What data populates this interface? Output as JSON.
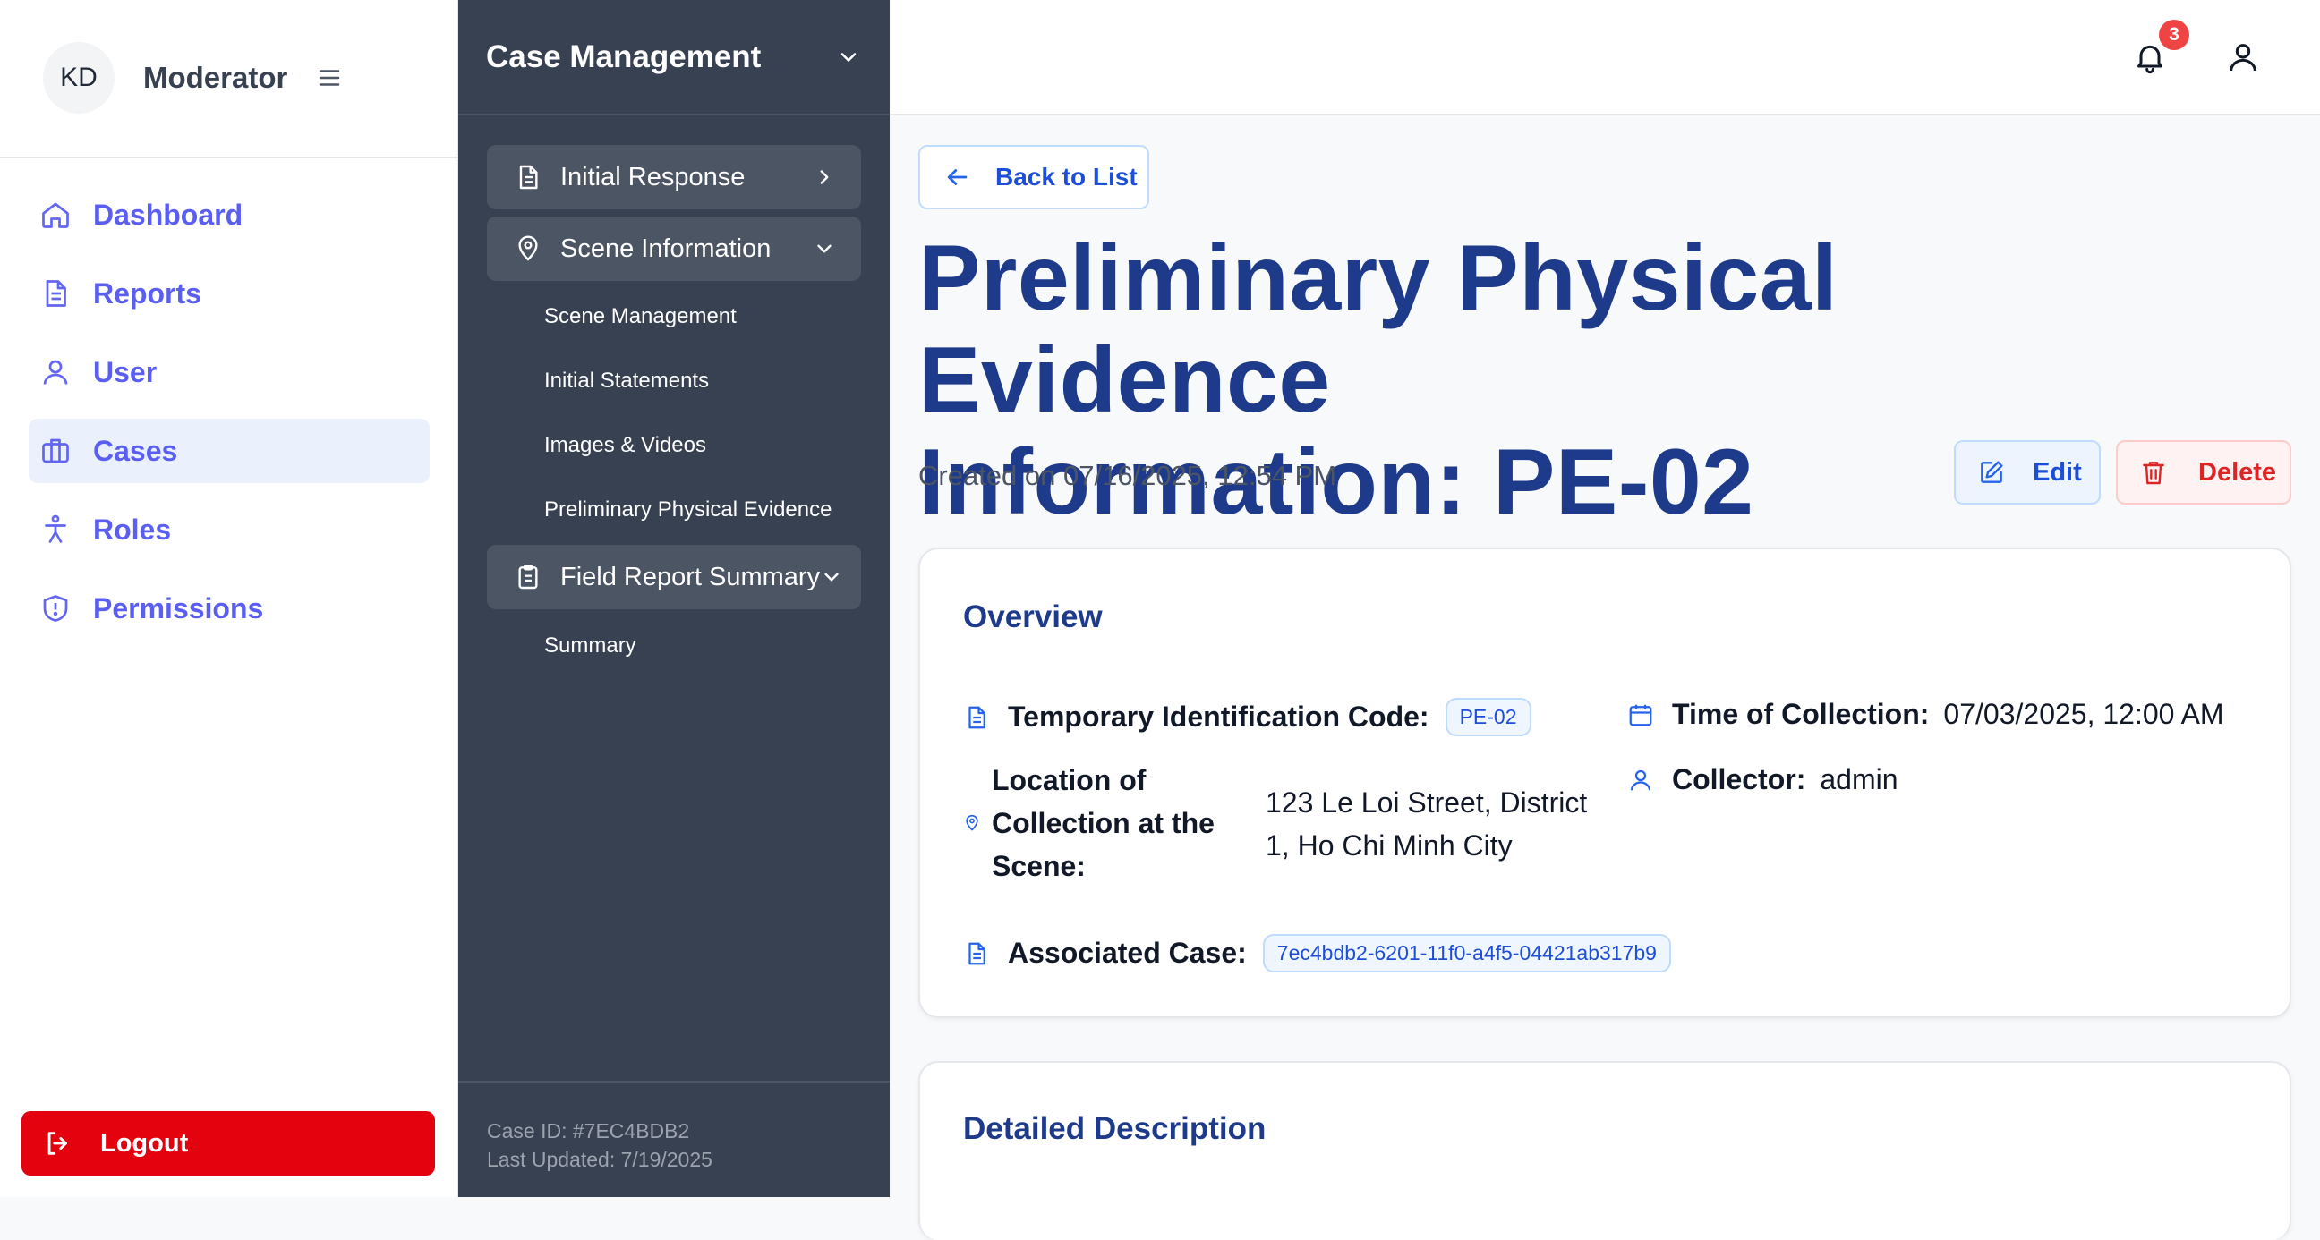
{
  "sidebar": {
    "avatar_initials": "KD",
    "role": "Moderator",
    "items": [
      {
        "label": "Dashboard",
        "icon": "home-icon"
      },
      {
        "label": "Reports",
        "icon": "document-icon"
      },
      {
        "label": "User",
        "icon": "user-icon"
      },
      {
        "label": "Cases",
        "icon": "briefcase-icon",
        "active": true
      },
      {
        "label": "Roles",
        "icon": "person-icon"
      },
      {
        "label": "Permissions",
        "icon": "shield-icon"
      }
    ],
    "logout_label": "Logout"
  },
  "case_panel": {
    "title": "Case Management",
    "groups": [
      {
        "label": "Initial Response",
        "expanded": false
      },
      {
        "label": "Scene Information",
        "expanded": true,
        "items": [
          "Scene Management",
          "Initial Statements",
          "Images & Videos",
          "Preliminary Physical Evidence"
        ]
      },
      {
        "label": "Field Report Summary",
        "expanded": true,
        "items": [
          "Summary"
        ]
      }
    ],
    "footer": {
      "case_id": "Case ID: #7EC4BDB2",
      "last_updated": "Last Updated: 7/19/2025"
    }
  },
  "topbar": {
    "notification_count": "3"
  },
  "main": {
    "back_label": "Back to List",
    "title_line1": "Preliminary Physical Evidence",
    "title_line2": "Information: PE-02",
    "created": "Created on 07/16/2025, 12:54 PM",
    "edit_label": "Edit",
    "delete_label": "Delete",
    "overview": {
      "title": "Overview",
      "temp_code_label": "Temporary Identification Code:",
      "temp_code_value": "PE-02",
      "time_label": "Time of Collection:",
      "time_value": "07/03/2025, 12:00 AM",
      "location_label": "Location of Collection at the Scene:",
      "location_value": "123 Le Loi Street, District 1, Ho Chi Minh City",
      "collector_label": "Collector:",
      "collector_value": "admin",
      "case_label": "Associated Case:",
      "case_value": "7ec4bdb2-6201-11f0-a4f5-04421ab317b9"
    },
    "detailed_description_title": "Detailed Description"
  },
  "colors": {
    "accent": "#2563eb",
    "title": "#1e3a8a",
    "nav_text": "#5b5ff1",
    "panel_bg": "#374151",
    "logout": "#e3020e",
    "delete": "#dc2626"
  }
}
